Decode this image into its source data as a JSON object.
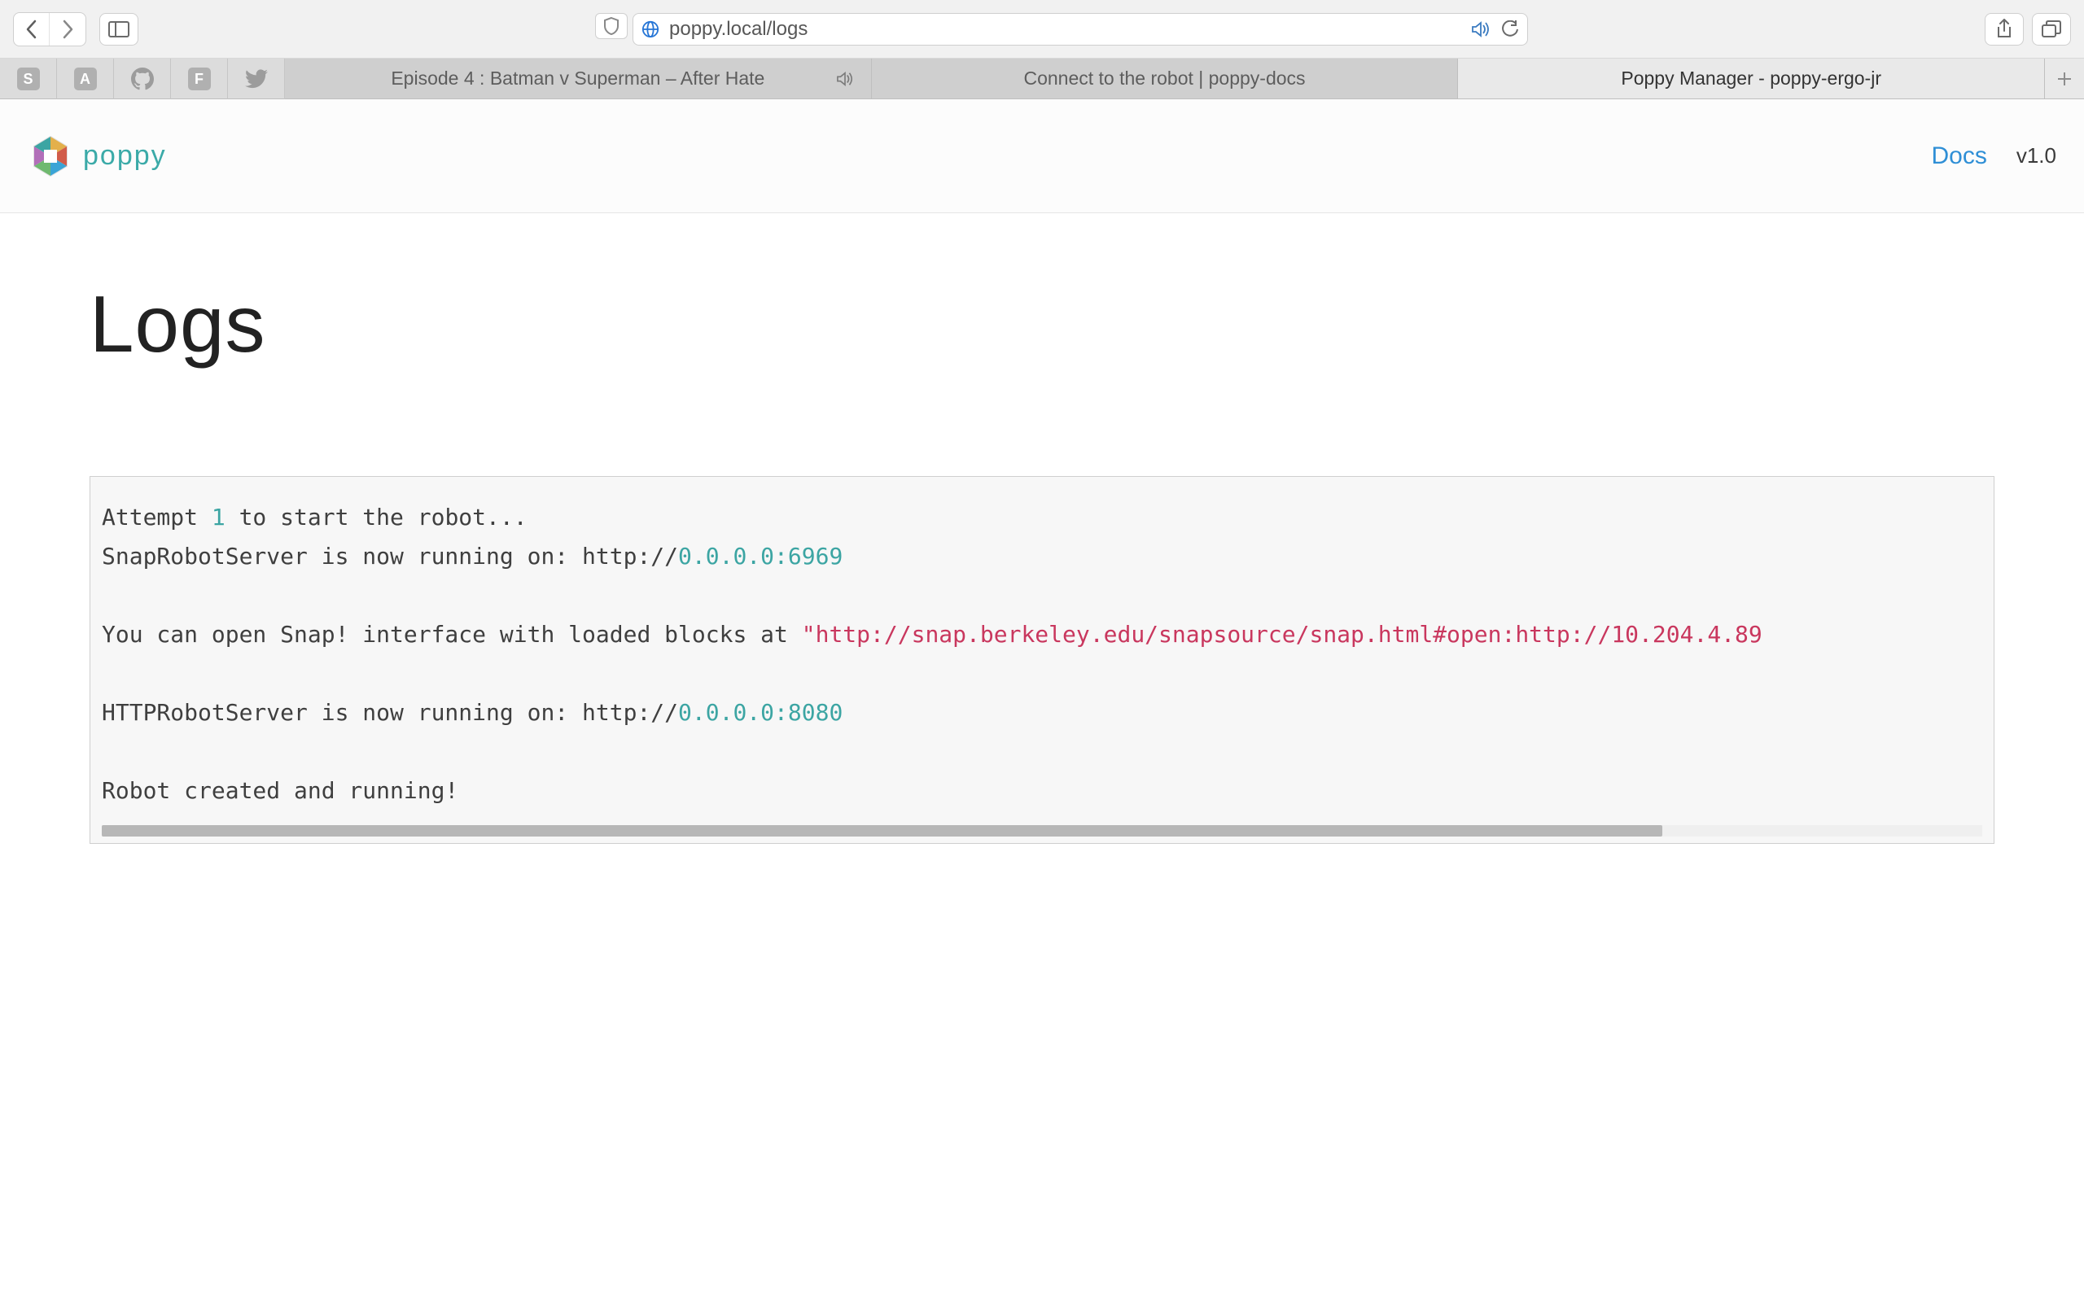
{
  "browser": {
    "url": "poppy.local/logs"
  },
  "favorites": {
    "items": [
      "S",
      "A",
      "github",
      "F",
      "twitter"
    ]
  },
  "tabs": {
    "items": [
      {
        "label": "Episode 4 : Batman v Superman – After Hate",
        "audio": true
      },
      {
        "label": "Connect to the robot | poppy-docs",
        "audio": false
      },
      {
        "label": "Poppy Manager - poppy-ergo-jr",
        "audio": false
      }
    ],
    "active_index": 2
  },
  "header": {
    "brand": "poppy",
    "docs_label": "Docs",
    "version": "v1.0"
  },
  "page": {
    "title": "Logs"
  },
  "logs": {
    "line1_prefix": "Attempt ",
    "line1_num": "1",
    "line1_suffix": " to start the robot...",
    "line2_prefix": "SnapRobotServer is now running on: http://",
    "line2_host": "0.0.0.0:6969",
    "line3_prefix": "You can open Snap! interface with loaded blocks at ",
    "line3_url": "\"http://snap.berkeley.edu/snapsource/snap.html#open:http://10.204.4.89",
    "line4_prefix": "HTTPRobotServer is now running on: http://",
    "line4_host": "0.0.0.0:8080",
    "line5": "Robot created and running!"
  }
}
